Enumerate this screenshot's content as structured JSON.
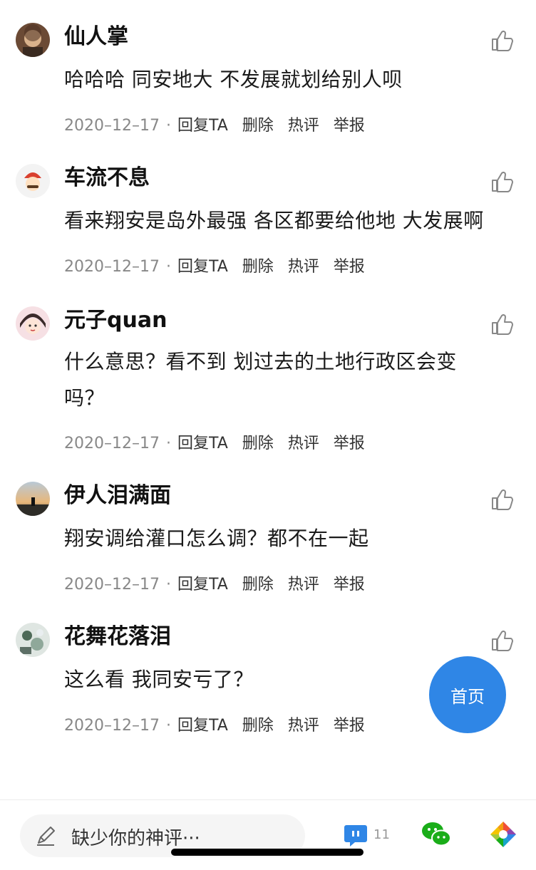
{
  "comments": [
    {
      "username": "仙人掌",
      "text": "哈哈哈 同安地大 不发展就划给别人呗",
      "date": "2020–12–17",
      "avatar": "portrait-painting"
    },
    {
      "username": "车流不息",
      "text": "看来翔安是岛外最强 各区都要给他地 大发展啊",
      "date": "2020–12–17",
      "avatar": "cartoon-mario"
    },
    {
      "username": "元子quan",
      "text": "什么意思？看不到 划过去的土地行政区会变吗？",
      "date": "2020–12–17",
      "avatar": "anime-girl"
    },
    {
      "username": "伊人泪满面",
      "text": "翔安调给灌口怎么调？都不在一起",
      "date": "2020–12–17",
      "avatar": "sunset-landscape"
    },
    {
      "username": "花舞花落泪",
      "text": "这么看 我同安亏了？",
      "date": "2020–12–17",
      "avatar": "flowers-photo"
    }
  ],
  "meta": {
    "separator": "·",
    "reply": "回复TA",
    "delete": "删除",
    "hot": "热评",
    "report": "举报"
  },
  "fab": {
    "label": "首页"
  },
  "bottom": {
    "placeholder": "缺少你的神评···",
    "comment_count": "11"
  },
  "colors": {
    "accent": "#2f86e6",
    "wechat": "#1aad19"
  }
}
